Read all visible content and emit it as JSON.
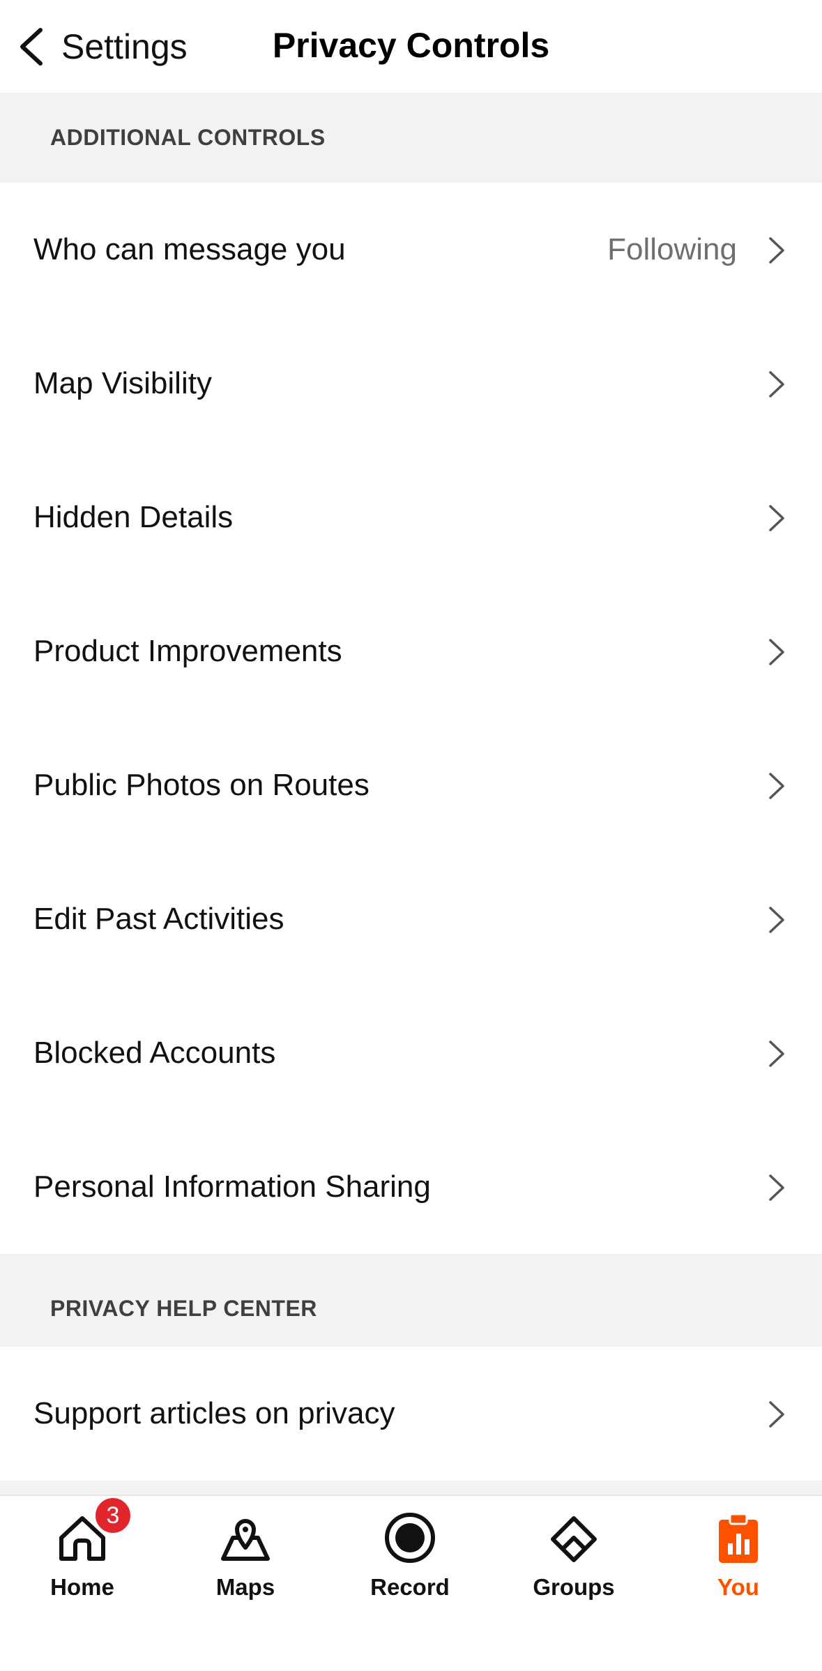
{
  "header": {
    "back_label": "Settings",
    "title": "Privacy Controls"
  },
  "sections": {
    "additional": {
      "title": "ADDITIONAL CONTROLS",
      "items": [
        {
          "label": "Who can message you",
          "value": "Following"
        },
        {
          "label": "Map Visibility"
        },
        {
          "label": "Hidden Details"
        },
        {
          "label": "Product Improvements"
        },
        {
          "label": "Public Photos on Routes"
        },
        {
          "label": "Edit Past Activities"
        },
        {
          "label": "Blocked Accounts"
        },
        {
          "label": "Personal Information Sharing"
        }
      ]
    },
    "help": {
      "title": "PRIVACY HELP CENTER",
      "items": [
        {
          "label": "Support articles on privacy"
        }
      ]
    }
  },
  "tabbar": {
    "items": [
      {
        "label": "Home",
        "icon": "home-icon",
        "badge": "3"
      },
      {
        "label": "Maps",
        "icon": "maps-icon"
      },
      {
        "label": "Record",
        "icon": "record-icon"
      },
      {
        "label": "Groups",
        "icon": "groups-icon"
      },
      {
        "label": "You",
        "icon": "you-icon",
        "active": true
      }
    ]
  },
  "colors": {
    "accent": "#fc5200",
    "badge": "#e0262a",
    "section_bg": "#f2f2f1",
    "secondary_text": "#6e6e6e"
  }
}
